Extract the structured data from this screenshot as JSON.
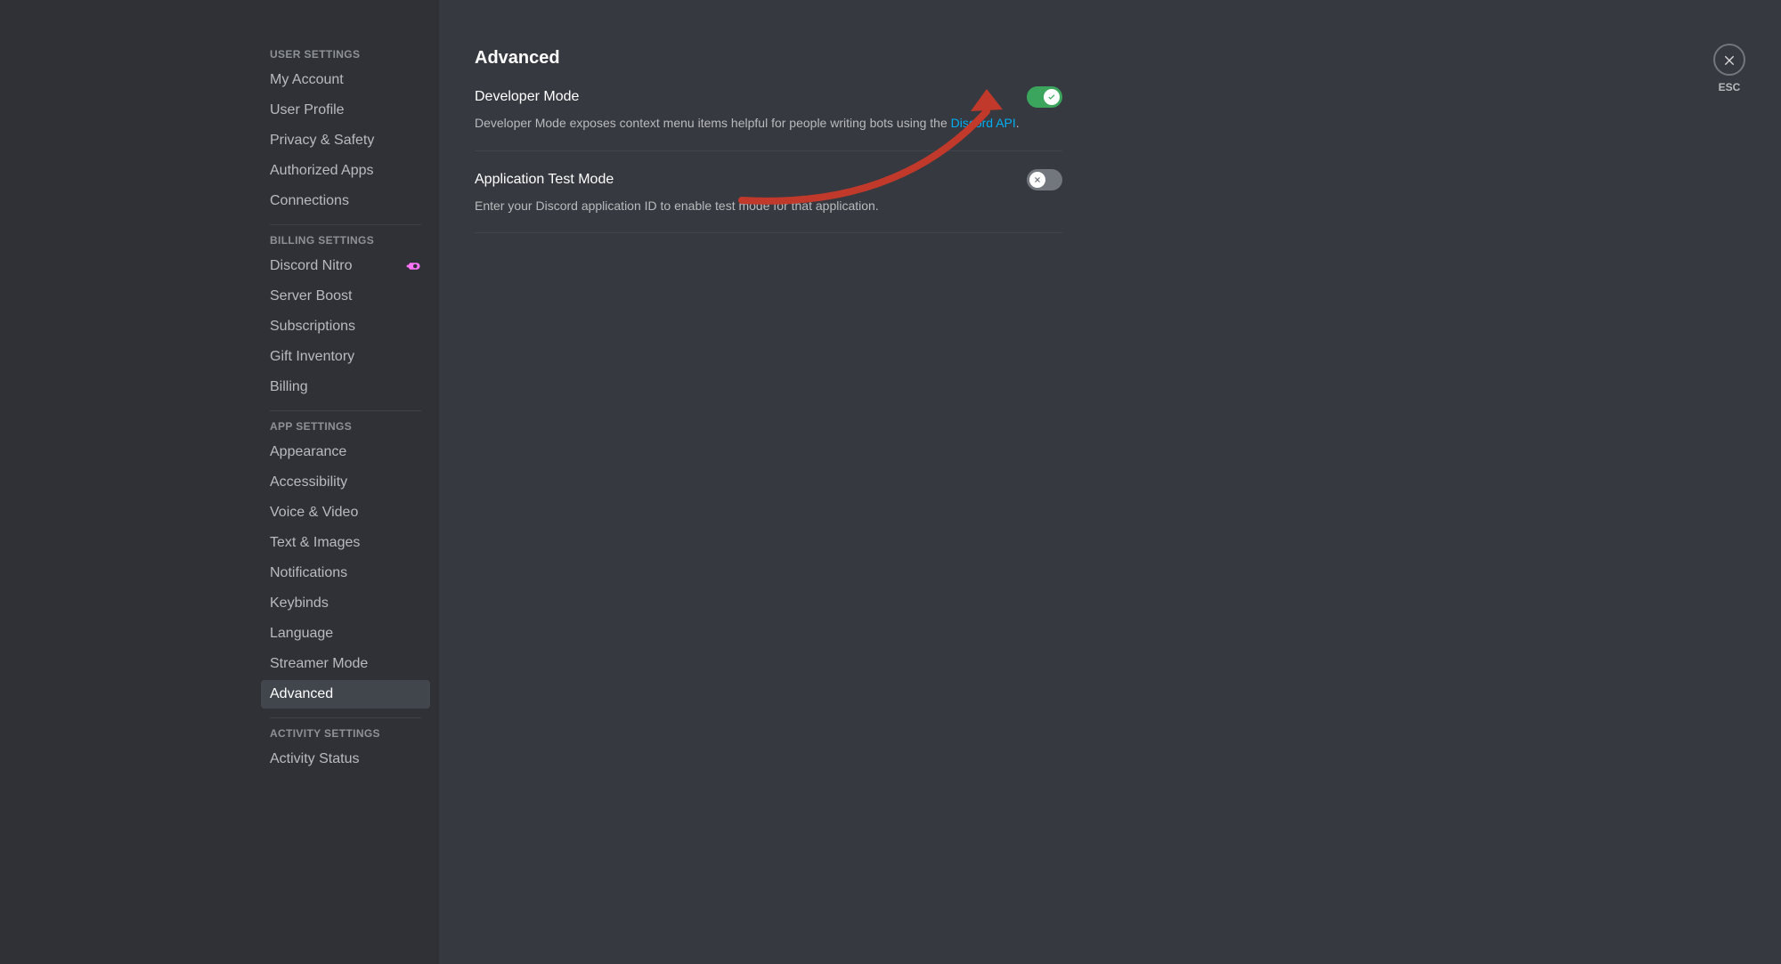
{
  "sidebar": {
    "sections": [
      {
        "header": "USER SETTINGS",
        "items": [
          {
            "label": "My Account"
          },
          {
            "label": "User Profile"
          },
          {
            "label": "Privacy & Safety"
          },
          {
            "label": "Authorized Apps"
          },
          {
            "label": "Connections"
          }
        ]
      },
      {
        "header": "BILLING SETTINGS",
        "items": [
          {
            "label": "Discord Nitro",
            "nitro": true
          },
          {
            "label": "Server Boost"
          },
          {
            "label": "Subscriptions"
          },
          {
            "label": "Gift Inventory"
          },
          {
            "label": "Billing"
          }
        ]
      },
      {
        "header": "APP SETTINGS",
        "items": [
          {
            "label": "Appearance"
          },
          {
            "label": "Accessibility"
          },
          {
            "label": "Voice & Video"
          },
          {
            "label": "Text & Images"
          },
          {
            "label": "Notifications"
          },
          {
            "label": "Keybinds"
          },
          {
            "label": "Language"
          },
          {
            "label": "Streamer Mode"
          },
          {
            "label": "Advanced",
            "active": true
          }
        ]
      },
      {
        "header": "ACTIVITY SETTINGS",
        "items": [
          {
            "label": "Activity Status"
          }
        ]
      }
    ]
  },
  "page": {
    "title": "Advanced",
    "close_label": "ESC"
  },
  "settings": {
    "developer_mode": {
      "label": "Developer Mode",
      "desc_before": "Developer Mode exposes context menu items helpful for people writing bots using the ",
      "link_text": "Discord API",
      "desc_after": ".",
      "enabled": true
    },
    "app_test_mode": {
      "label": "Application Test Mode",
      "desc": "Enter your Discord application ID to enable test mode for that application.",
      "enabled": false
    }
  },
  "annotation": {
    "arrow_color": "#c0392b"
  }
}
